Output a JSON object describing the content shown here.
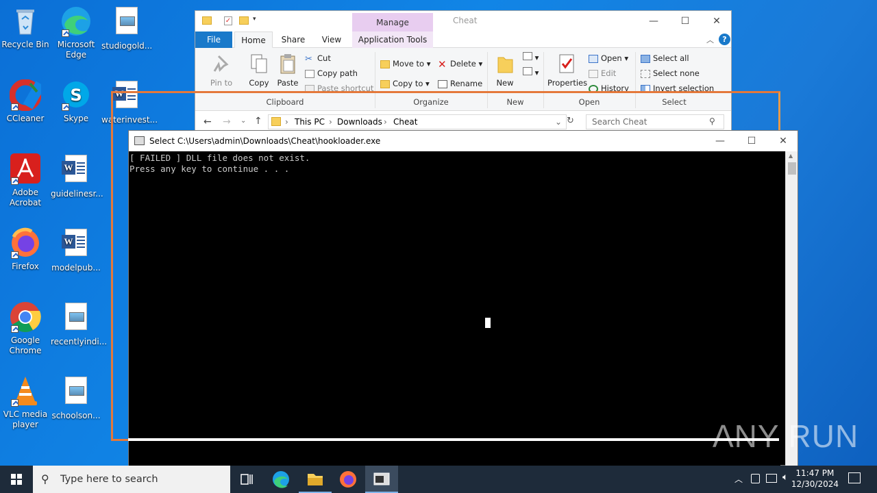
{
  "desktop_icons": [
    {
      "label": "Recycle Bin",
      "icon": "recycle-bin-icon"
    },
    {
      "label": "Microsoft Edge",
      "icon": "edge-icon"
    },
    {
      "label": "studiogold...",
      "icon": "image-file-icon"
    },
    {
      "label": "CCleaner",
      "icon": "ccleaner-icon"
    },
    {
      "label": "Skype",
      "icon": "skype-icon"
    },
    {
      "label": "waterinvest...",
      "icon": "word-doc-icon"
    },
    {
      "label": "Adobe Acrobat",
      "icon": "acrobat-icon"
    },
    {
      "label": "guidelinesr...",
      "icon": "word-doc-icon"
    },
    {
      "label": "Firefox",
      "icon": "firefox-icon"
    },
    {
      "label": "modelpub...",
      "icon": "word-doc-icon"
    },
    {
      "label": "Google Chrome",
      "icon": "chrome-icon"
    },
    {
      "label": "recentlyindi...",
      "icon": "image-file-icon"
    },
    {
      "label": "VLC media player",
      "icon": "vlc-icon"
    },
    {
      "label": "schoolson...",
      "icon": "image-file-icon"
    }
  ],
  "explorer": {
    "title": "Cheat",
    "manage_label": "Manage",
    "tabs": {
      "file": "File",
      "home": "Home",
      "share": "Share",
      "view": "View",
      "app_tools": "Application Tools"
    },
    "clipboard": {
      "pin": "Pin to Quick access",
      "copy": "Copy",
      "paste": "Paste",
      "cut": "Cut",
      "copy_path": "Copy path",
      "paste_shortcut": "Paste shortcut",
      "group": "Clipboard"
    },
    "organize": {
      "move_to": "Move to",
      "copy_to": "Copy to",
      "delete": "Delete",
      "rename": "Rename",
      "group": "Organize"
    },
    "new": {
      "new_folder": "New folder",
      "group": "New"
    },
    "open": {
      "properties": "Properties",
      "open": "Open",
      "edit": "Edit",
      "history": "History",
      "group": "Open"
    },
    "select": {
      "select_all": "Select all",
      "select_none": "Select none",
      "invert": "Invert selection",
      "group": "Select"
    },
    "breadcrumb": [
      "This PC",
      "Downloads",
      "Cheat"
    ],
    "search_placeholder": "Search Cheat"
  },
  "console": {
    "title": "Select C:\\Users\\admin\\Downloads\\Cheat\\hookloader.exe",
    "lines": [
      "[ FAILED ] DLL file does not exist.",
      "Press any key to continue . . ."
    ]
  },
  "watermark": "ANY RUN",
  "taskbar": {
    "search_placeholder": "Type here to search",
    "time": "11:47 PM",
    "date": "12/30/2024"
  },
  "colors": {
    "accent": "#1979ca",
    "desktop": "#1185e6",
    "manage_band": "#e8cdf0",
    "selection_frame": "#e4783a"
  }
}
